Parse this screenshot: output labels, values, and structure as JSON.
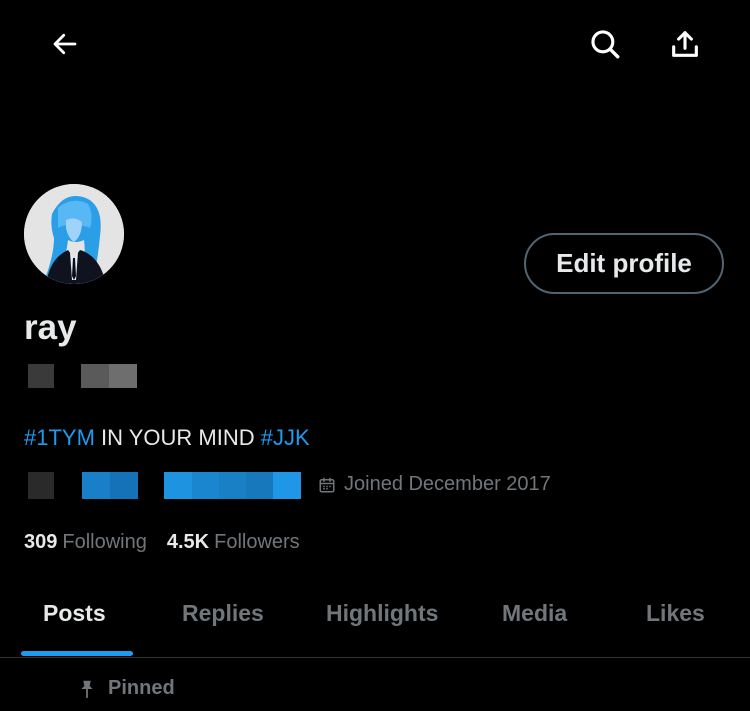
{
  "header": {
    "back_icon": "arrow-left-icon",
    "search_icon": "search-icon",
    "share_icon": "share-upload-icon"
  },
  "profile": {
    "display_name": "ray",
    "edit_button_label": "Edit profile",
    "bio": {
      "hashtag_1": "#1TYM",
      "text": " IN YOUR MIND ",
      "hashtag_2": "#JJK"
    },
    "joined": "Joined December 2017",
    "following_count": "309",
    "following_label": "Following",
    "followers_count": "4.5K",
    "followers_label": "Followers"
  },
  "tabs": [
    {
      "label": "Posts",
      "active": true
    },
    {
      "label": "Replies",
      "active": false
    },
    {
      "label": "Highlights",
      "active": false
    },
    {
      "label": "Media",
      "active": false
    },
    {
      "label": "Likes",
      "active": false
    }
  ],
  "pinned_label": "Pinned",
  "colors": {
    "background": "#000000",
    "accent": "#1d9bf0",
    "text_primary": "#e7e9ea",
    "text_secondary": "#71767b",
    "border": "#536471"
  }
}
